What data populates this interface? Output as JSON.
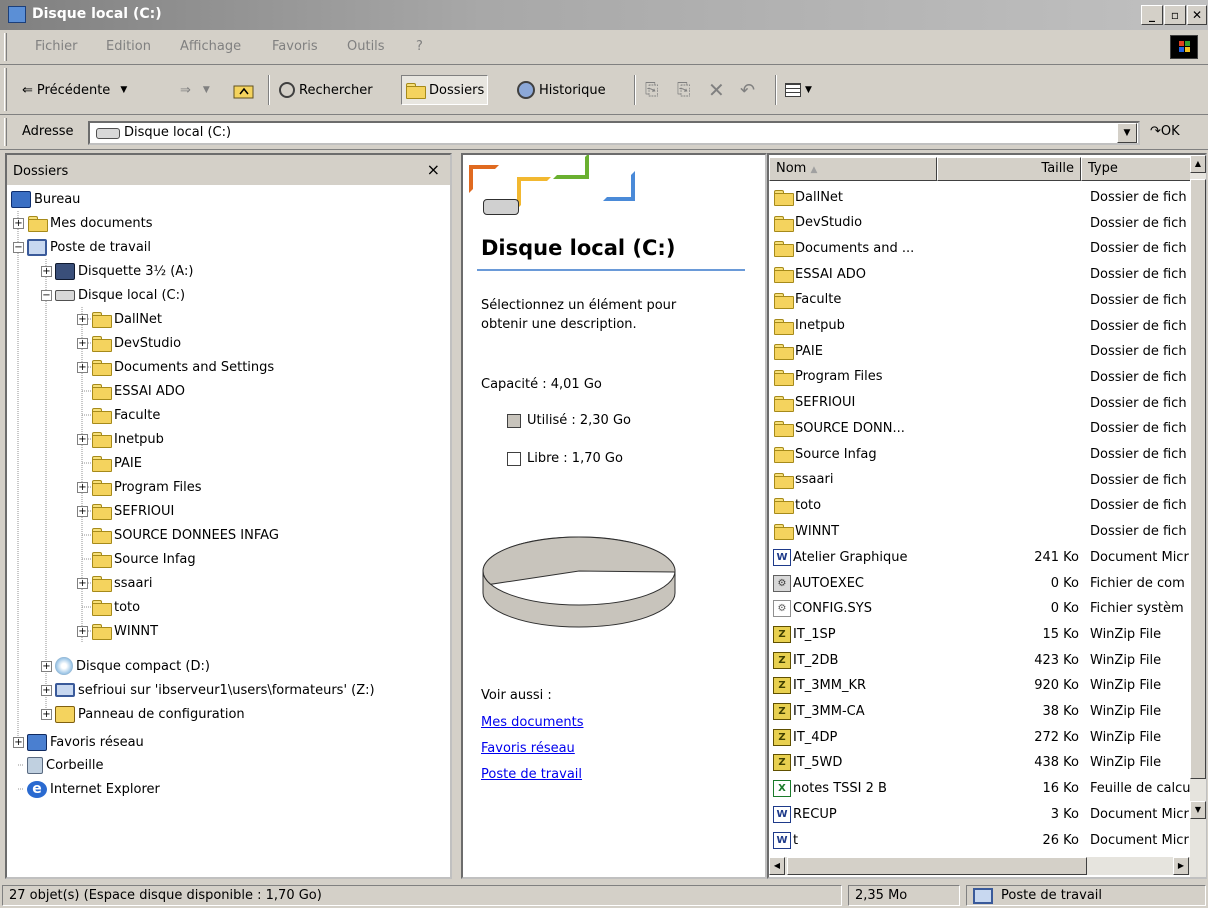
{
  "window": {
    "title": "Disque local (C:)",
    "buttons": [
      "_",
      "▫",
      "✕"
    ]
  },
  "menu": [
    "Fichier",
    "Edition",
    "Affichage",
    "Favoris",
    "Outils",
    "?"
  ],
  "toolbar": {
    "back": "Précédente",
    "search": "Rechercher",
    "folders": "Dossiers",
    "history": "Historique"
  },
  "address": {
    "label": "Adresse",
    "value": "Disque local (C:)",
    "go": "OK"
  },
  "folders_pane": {
    "title": "Dossiers",
    "close": "×",
    "tree": [
      {
        "label": "Bureau",
        "icon": "desktop-icon"
      },
      {
        "label": "Mes documents",
        "icon": "my-documents-icon"
      },
      {
        "label": "Poste de travail",
        "icon": "my-computer-icon"
      },
      {
        "label": "Disquette 3½ (A:)",
        "icon": "floppy-icon"
      },
      {
        "label": "Disque local (C:)",
        "icon": "hard-disk-icon"
      },
      {
        "label": "DallNet",
        "icon": "folder-icon"
      },
      {
        "label": "DevStudio",
        "icon": "folder-icon"
      },
      {
        "label": "Documents and Settings",
        "icon": "folder-icon"
      },
      {
        "label": "ESSAI ADO",
        "icon": "folder-icon"
      },
      {
        "label": "Faculte",
        "icon": "folder-icon"
      },
      {
        "label": "Inetpub",
        "icon": "folder-icon"
      },
      {
        "label": "PAIE",
        "icon": "folder-icon"
      },
      {
        "label": "Program Files",
        "icon": "folder-icon"
      },
      {
        "label": "SEFRIOUI",
        "icon": "folder-icon"
      },
      {
        "label": "SOURCE DONNEES INFAG",
        "icon": "folder-icon"
      },
      {
        "label": "Source Infag",
        "icon": "folder-icon"
      },
      {
        "label": "ssaari",
        "icon": "shared-folder-icon"
      },
      {
        "label": "toto",
        "icon": "folder-icon"
      },
      {
        "label": "WINNT",
        "icon": "folder-icon"
      },
      {
        "label": "Disque compact (D:)",
        "icon": "cd-drive-icon"
      },
      {
        "label": "sefrioui sur 'ibserveur1\\users\\formateurs' (Z:)",
        "icon": "network-drive-icon"
      },
      {
        "label": "Panneau de configuration",
        "icon": "control-panel-icon"
      },
      {
        "label": "Favoris réseau",
        "icon": "network-icon"
      },
      {
        "label": "Corbeille",
        "icon": "recycle-bin-icon"
      },
      {
        "label": "Internet Explorer",
        "icon": "ie-icon"
      }
    ]
  },
  "web_pane": {
    "title": "Disque local (C:)",
    "description": "Sélectionnez un élément pour obtenir une description.",
    "capacity": "Capacité : 4,01 Go",
    "used": "Utilisé : 2,30 Go",
    "free": "Libre : 1,70 Go",
    "used_fraction": 0.574,
    "see_also": "Voir aussi :",
    "links": [
      "Mes documents",
      "Favoris réseau",
      "Poste de travail"
    ],
    "colors": {
      "used": "#c8c4bc",
      "free": "#ffffff"
    }
  },
  "file_list": {
    "columns": [
      "Nom",
      "Taille",
      "Type"
    ],
    "rows": [
      {
        "name": "DallNet",
        "size": "",
        "type": "Dossier de fich",
        "icon": "folder-icon"
      },
      {
        "name": "DevStudio",
        "size": "",
        "type": "Dossier de fich",
        "icon": "folder-icon"
      },
      {
        "name": "Documents and ...",
        "size": "",
        "type": "Dossier de fich",
        "icon": "folder-icon"
      },
      {
        "name": "ESSAI ADO",
        "size": "",
        "type": "Dossier de fich",
        "icon": "folder-icon"
      },
      {
        "name": "Faculte",
        "size": "",
        "type": "Dossier de fich",
        "icon": "folder-icon"
      },
      {
        "name": "Inetpub",
        "size": "",
        "type": "Dossier de fich",
        "icon": "folder-icon"
      },
      {
        "name": "PAIE",
        "size": "",
        "type": "Dossier de fich",
        "icon": "folder-icon"
      },
      {
        "name": "Program Files",
        "size": "",
        "type": "Dossier de fich",
        "icon": "folder-icon"
      },
      {
        "name": "SEFRIOUI",
        "size": "",
        "type": "Dossier de fich",
        "icon": "folder-icon"
      },
      {
        "name": "SOURCE DONN...",
        "size": "",
        "type": "Dossier de fich",
        "icon": "folder-icon"
      },
      {
        "name": "Source Infag",
        "size": "",
        "type": "Dossier de fich",
        "icon": "folder-icon"
      },
      {
        "name": "ssaari",
        "size": "",
        "type": "Dossier de fich",
        "icon": "shared-folder-icon"
      },
      {
        "name": "toto",
        "size": "",
        "type": "Dossier de fich",
        "icon": "folder-icon"
      },
      {
        "name": "WINNT",
        "size": "",
        "type": "Dossier de fich",
        "icon": "folder-icon"
      },
      {
        "name": "Atelier Graphique",
        "size": "241 Ko",
        "type": "Document Micr",
        "icon": "word-doc-icon"
      },
      {
        "name": "AUTOEXEC",
        "size": "0 Ko",
        "type": "Fichier de com",
        "icon": "batch-file-icon"
      },
      {
        "name": "CONFIG.SYS",
        "size": "0 Ko",
        "type": "Fichier systèm",
        "icon": "system-file-icon"
      },
      {
        "name": "IT_1SP",
        "size": "15 Ko",
        "type": "WinZip File",
        "icon": "winzip-icon"
      },
      {
        "name": "IT_2DB",
        "size": "423 Ko",
        "type": "WinZip File",
        "icon": "winzip-icon"
      },
      {
        "name": "IT_3MM_KR",
        "size": "920 Ko",
        "type": "WinZip File",
        "icon": "winzip-icon"
      },
      {
        "name": "IT_3MM-CA",
        "size": "38 Ko",
        "type": "WinZip File",
        "icon": "winzip-icon"
      },
      {
        "name": "IT_4DP",
        "size": "272 Ko",
        "type": "WinZip File",
        "icon": "winzip-icon"
      },
      {
        "name": "IT_5WD",
        "size": "438 Ko",
        "type": "WinZip File",
        "icon": "winzip-icon"
      },
      {
        "name": "notes TSSI 2 B",
        "size": "16 Ko",
        "type": "Feuille de calcu",
        "icon": "excel-icon"
      },
      {
        "name": "RECUP",
        "size": "3 Ko",
        "type": "Document Micr",
        "icon": "word-doc-icon"
      },
      {
        "name": "t",
        "size": "26 Ko",
        "type": "Document Micr",
        "icon": "word-doc-icon"
      }
    ]
  },
  "status": {
    "objects": "27 objet(s) (Espace disque disponible : 1,70 Go)",
    "size": "2,35 Mo",
    "zone": "Poste de travail"
  }
}
